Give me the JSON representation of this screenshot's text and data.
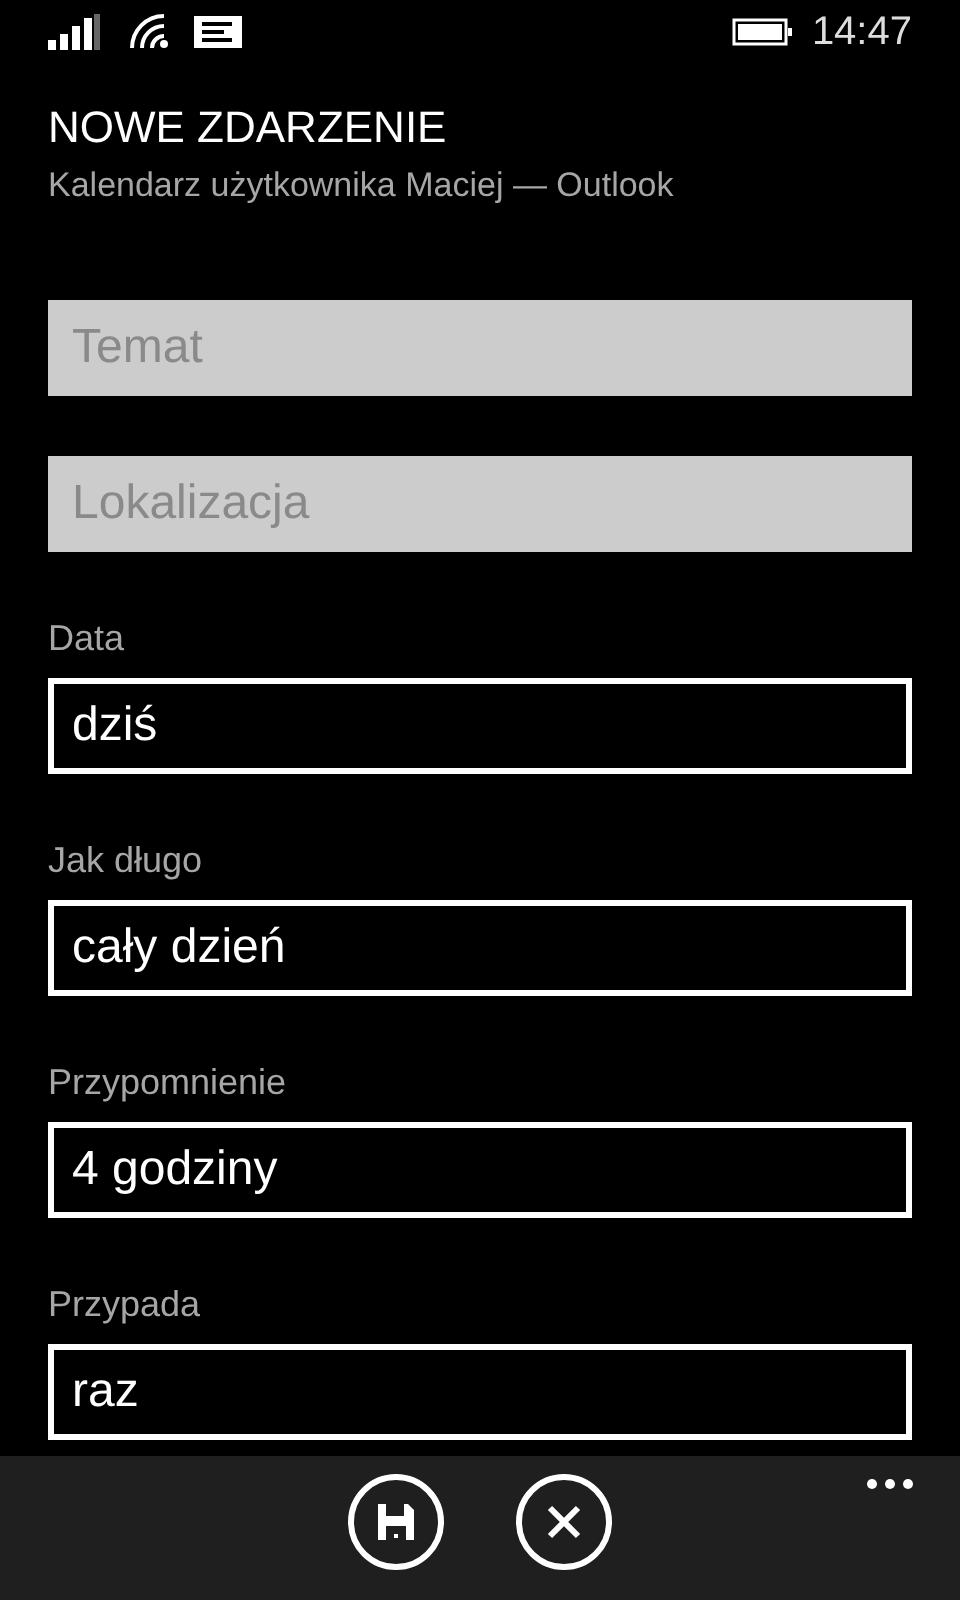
{
  "status_bar": {
    "time": "14:47"
  },
  "header": {
    "title": "NOWE ZDARZENIE",
    "subtitle": "Kalendarz użytkownika Maciej — Outlook"
  },
  "fields": [
    {
      "kind": "text",
      "placeholder": "Temat"
    },
    {
      "kind": "text",
      "placeholder": "Lokalizacja"
    },
    {
      "kind": "picker",
      "label": "Data",
      "value": "dziś"
    },
    {
      "kind": "picker",
      "label": "Jak długo",
      "value": "cały dzień"
    },
    {
      "kind": "picker",
      "label": "Przypomnienie",
      "value": "4 godziny"
    },
    {
      "kind": "picker",
      "label": "Przypada",
      "value": "raz"
    }
  ],
  "app_bar": {
    "buttons": [
      {
        "kind": "save"
      },
      {
        "kind": "cancel"
      }
    ]
  }
}
